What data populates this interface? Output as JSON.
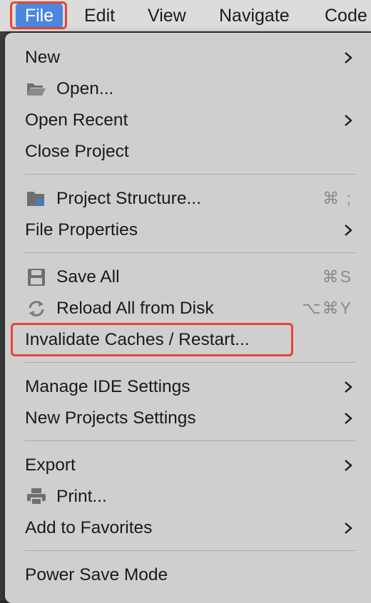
{
  "menubar": {
    "items": [
      "File",
      "Edit",
      "View",
      "Navigate",
      "Code"
    ]
  },
  "menu": {
    "new": "New",
    "open": "Open...",
    "open_recent": "Open Recent",
    "close_project": "Close Project",
    "project_structure": "Project Structure...",
    "project_structure_shortcut": "⌘ ;",
    "file_properties": "File Properties",
    "save_all": "Save All",
    "save_all_shortcut": "⌘S",
    "reload_all": "Reload All from Disk",
    "reload_all_shortcut": "⌥⌘Y",
    "invalidate": "Invalidate Caches / Restart...",
    "manage_ide": "Manage IDE Settings",
    "new_projects_settings": "New Projects Settings",
    "export": "Export",
    "print": "Print...",
    "add_to_favorites": "Add to Favorites",
    "power_save": "Power Save Mode"
  },
  "colors": {
    "highlight_box": "#e8442f",
    "menu_bg": "#cfcfcf"
  }
}
